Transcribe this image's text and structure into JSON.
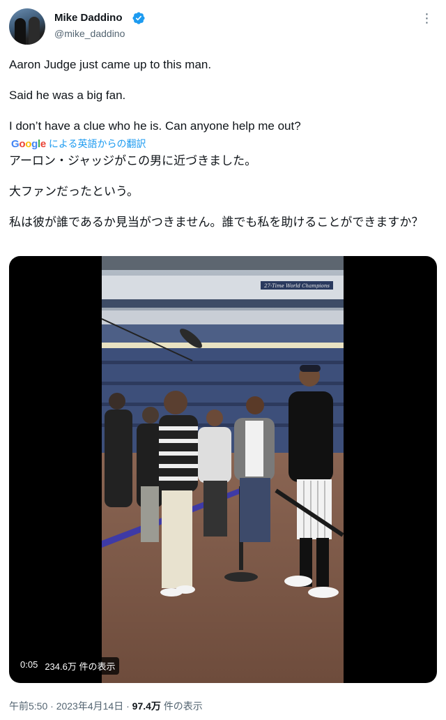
{
  "user": {
    "name": "Mike Daddino",
    "handle": "@mike_daddino"
  },
  "tweet": {
    "lines": [
      "Aaron Judge just came up to this man.",
      "Said he was a big fan.",
      "I don’t have a clue who he is. Can anyone help me out?"
    ]
  },
  "translation": {
    "google_letters": [
      "G",
      "o",
      "o",
      "g",
      "l",
      "e"
    ],
    "label": "による英語からの翻訳",
    "lines": [
      "アーロン・ジャッジがこの男に近づきました。",
      "大ファンだったという。",
      "私は彼が誰であるか見当がつきません。誰でも私を助けることができますか？"
    ]
  },
  "video": {
    "duration": "0:05",
    "views": "234.6万 件の表示",
    "banner_text": "27-Time World Champions"
  },
  "meta": {
    "time": "午前5:50",
    "separator": "·",
    "date": "2023年4月14日",
    "views_count": "97.4万",
    "views_label": "件の表示"
  },
  "colors": {
    "link": "#1d9bf0",
    "verified": "#1d9bf0",
    "secondary_text": "#536471"
  }
}
